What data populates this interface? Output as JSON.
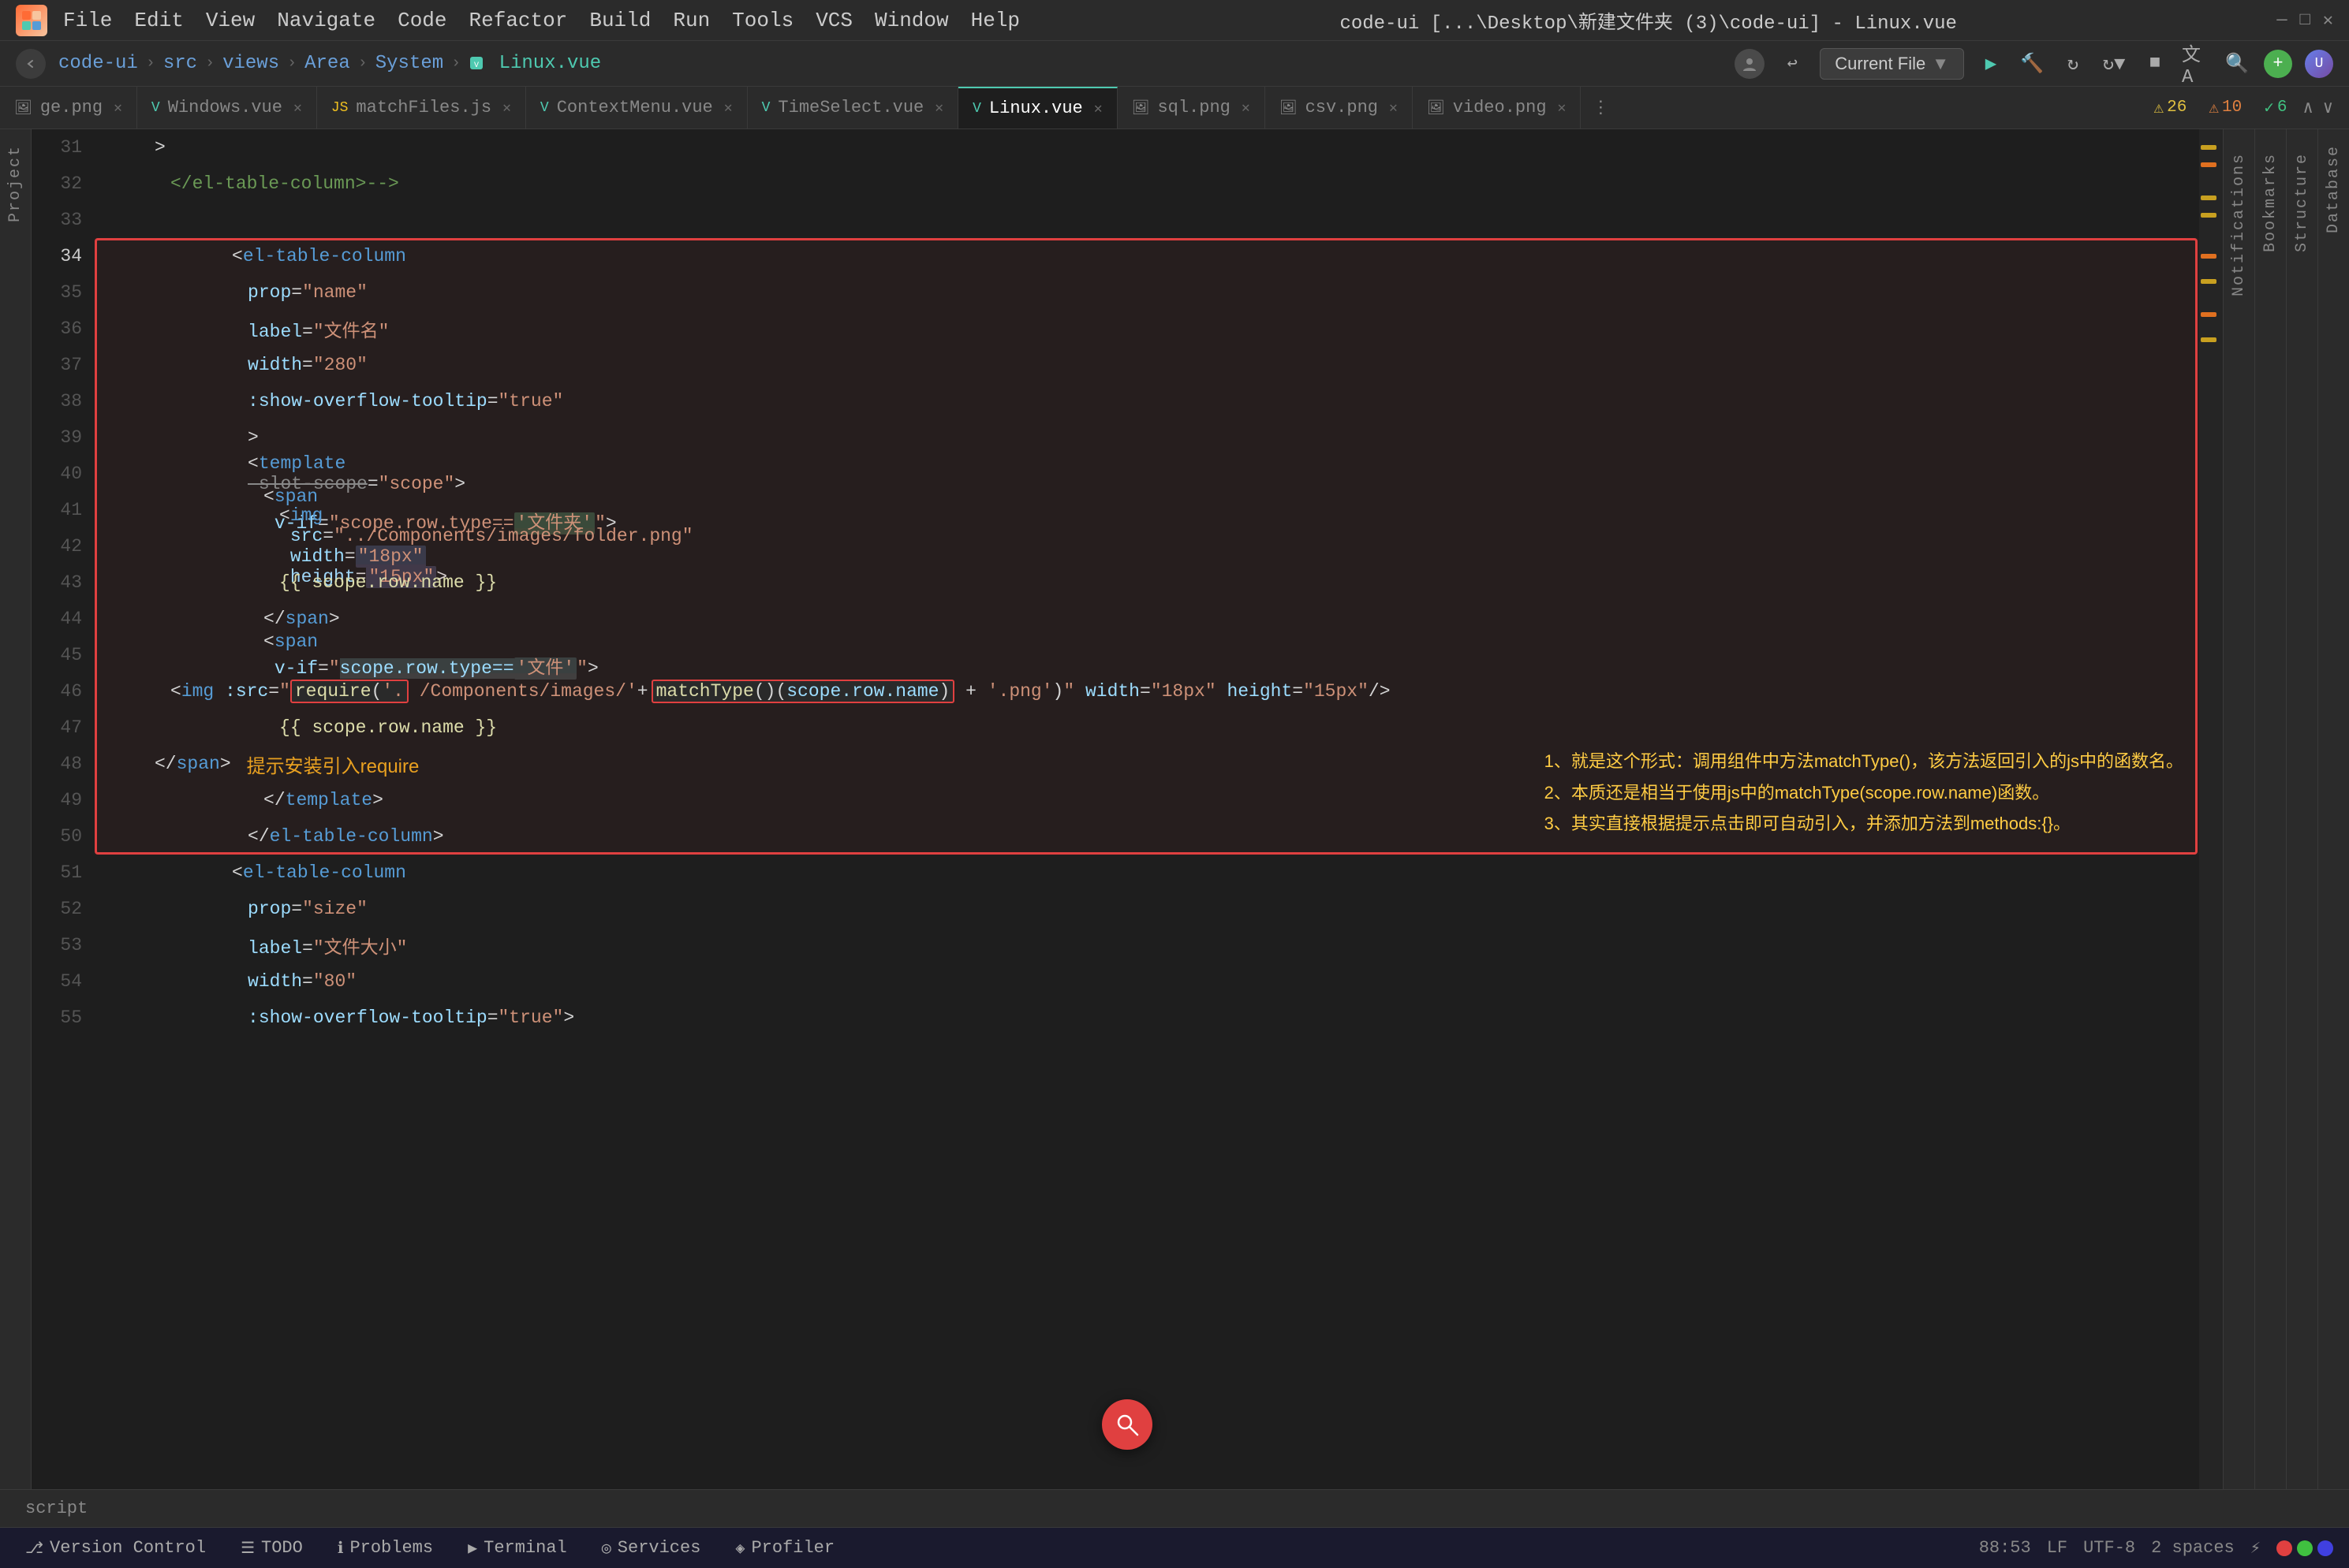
{
  "titleBar": {
    "appIcon": "✦",
    "menus": [
      "File",
      "Edit",
      "View",
      "Navigate",
      "Code",
      "Refactor",
      "Build",
      "Run",
      "Tools",
      "VCS",
      "Window",
      "Help"
    ],
    "title": "code-ui [...\\Desktop\\新建文件夹 (3)\\code-ui] - Linux.vue",
    "windowControls": [
      "—",
      "□",
      "✕"
    ]
  },
  "navBar": {
    "breadcrumb": [
      "code-ui",
      "src",
      "views",
      "Area",
      "System",
      "Linux.vue"
    ],
    "currentFileBtnLabel": "Current File",
    "runIcon": "▶",
    "buildIcon": "🔨",
    "refreshIcon": "↻",
    "translateIcon": "文A",
    "searchIcon": "🔍",
    "plusIcon": "+",
    "userIcon": "👤"
  },
  "tabs": [
    {
      "label": "ge.png",
      "type": "image",
      "active": false
    },
    {
      "label": "Windows.vue",
      "type": "vue",
      "active": false
    },
    {
      "label": "matchFiles.js",
      "type": "js",
      "active": false
    },
    {
      "label": "ContextMenu.vue",
      "type": "vue",
      "active": false
    },
    {
      "label": "TimeSelect.vue",
      "type": "vue",
      "active": false
    },
    {
      "label": "Linux.vue",
      "type": "vue",
      "active": true
    },
    {
      "label": "sql.png",
      "type": "image",
      "active": false
    },
    {
      "label": "csv.png",
      "type": "image",
      "active": false
    },
    {
      "label": "video.png",
      "type": "image",
      "active": false
    }
  ],
  "warnings": {
    "yellow_icon": "⚠",
    "yellow_count": "26",
    "orange_icon": "⚠",
    "orange_count": "10",
    "check_icon": "✓",
    "check_count": "6"
  },
  "codeLines": [
    {
      "num": 31,
      "indent": 2,
      "content": ">"
    },
    {
      "num": 32,
      "indent": 3,
      "content": "</el-table-column>-->"
    },
    {
      "num": 33,
      "indent": 0,
      "content": ""
    },
    {
      "num": 34,
      "indent": 1,
      "content": "<el-table-column"
    },
    {
      "num": 35,
      "indent": 2,
      "content": "prop=\"name\""
    },
    {
      "num": 36,
      "indent": 2,
      "content": "label=\"文件名\""
    },
    {
      "num": 37,
      "indent": 2,
      "content": "width=\"280\""
    },
    {
      "num": 38,
      "indent": 2,
      "content": ":show-overflow-tooltip=\"true\""
    },
    {
      "num": 39,
      "indent": 2,
      "content": ">"
    },
    {
      "num": 40,
      "indent": 2,
      "content": "<template slot-scope=\"scope\">"
    },
    {
      "num": 41,
      "indent": 3,
      "content": "<span v-if=\"scope.row.type=='文件夹'\">"
    },
    {
      "num": 42,
      "indent": 4,
      "content": "<img src=\"../Components/images/folder.png\" width=\"18px\" height=\"15px\">"
    },
    {
      "num": 43,
      "indent": 4,
      "content": "{{ scope.row.name }}"
    },
    {
      "num": 44,
      "indent": 3,
      "content": "</span>"
    },
    {
      "num": 45,
      "indent": 3,
      "content": "<span v-if=\"scope.row.type=='文件'\">"
    },
    {
      "num": 46,
      "indent": 4,
      "content": "<img :src=\"require('./. /Components/images/\" + matchType()(scope.row.name) + '.png') width=\"18px\" height=\"15px\"/>"
    },
    {
      "num": 47,
      "indent": 4,
      "content": "{{ scope.row.name }}"
    },
    {
      "num": 48,
      "indent": 3,
      "content": "</span>"
    },
    {
      "num": 49,
      "indent": 3,
      "content": "</template>"
    },
    {
      "num": 50,
      "indent": 2,
      "content": "</el-table-column>"
    },
    {
      "num": 51,
      "indent": 1,
      "content": "<el-table-column"
    },
    {
      "num": 52,
      "indent": 2,
      "content": "prop=\"size\""
    },
    {
      "num": 53,
      "indent": 2,
      "content": "label=\"文件大小\""
    },
    {
      "num": 54,
      "indent": 2,
      "content": "width=\"80\""
    },
    {
      "num": 55,
      "indent": 2,
      "content": ":show-overflow-tooltip=\"true\">"
    }
  ],
  "annotations": {
    "hint_require": "提示安装引入require",
    "comment1": "1、就是这个形式：调用组件中方法matchType()，该方法返回引入的js中的函数名。",
    "comment2": "2、本质还是相当于使用js中的matchType(scope.row.name)函数。",
    "comment3": "3、其实直接根据提示点击即可自动引入，并添加方法到methods:{}。"
  },
  "scrollMarks": {
    "marks": [
      "yellow",
      "orange",
      "yellow",
      "yellow",
      "orange",
      "yellow",
      "orange",
      "yellow"
    ]
  },
  "statusBar": {
    "script_label": "script",
    "versionControl": "Version Control",
    "todo": "TODO",
    "problems": "Problems",
    "terminal": "Terminal",
    "services": "Services",
    "profiler": "Profiler",
    "position": "88:53",
    "lineEnding": "LF",
    "encoding": "UTF-8",
    "indent": "2 spaces"
  },
  "sidebar": {
    "project_label": "Project",
    "database_label": "Database",
    "notifications_label": "Notifications",
    "bookmarks_label": "Bookmarks",
    "structure_label": "Structure"
  }
}
